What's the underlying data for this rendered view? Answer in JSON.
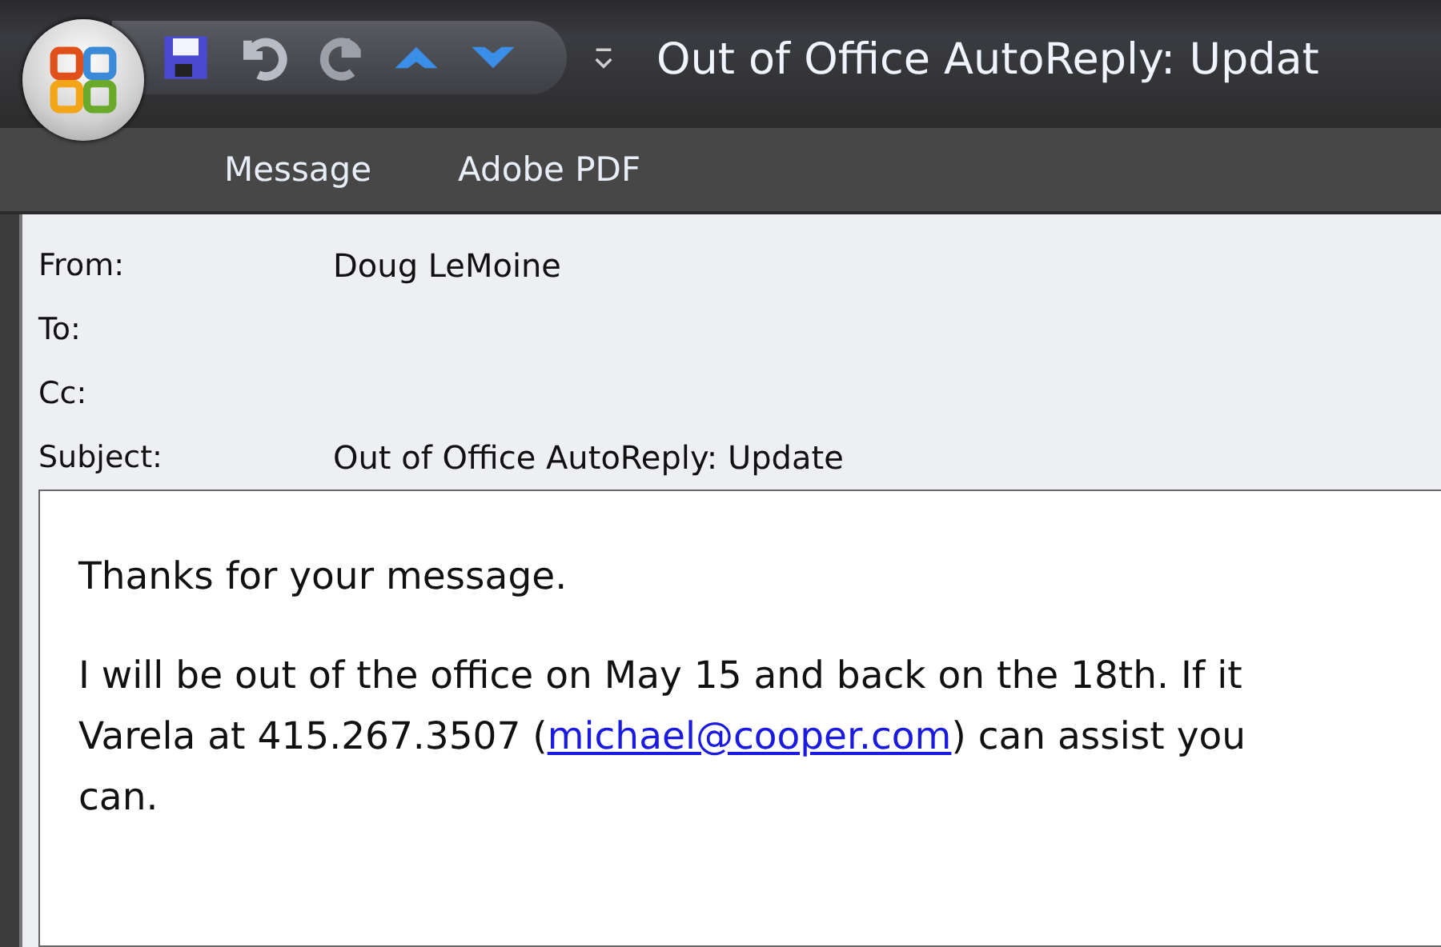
{
  "window": {
    "title": "Out of Office AutoReply: Updat"
  },
  "ribbon_tabs": [
    {
      "label": "Message"
    },
    {
      "label": "Adobe PDF"
    }
  ],
  "header_fields": [
    {
      "label": "From:",
      "value": "Doug LeMoine"
    },
    {
      "label": "To:"
    },
    {
      "label": "Cc:"
    },
    {
      "label": "Subject:",
      "value": "Out of Office AutoReply: Update"
    }
  ],
  "body": {
    "greeting": "Thanks for your message.",
    "paragraph": {
      "before_link": "I will be out of the office on May 15 and back on the 18th. If it\nVarela at 415.267.3507 (",
      "link": "michael@cooper.com",
      "after_link": ") can assist you\ncan."
    }
  }
}
